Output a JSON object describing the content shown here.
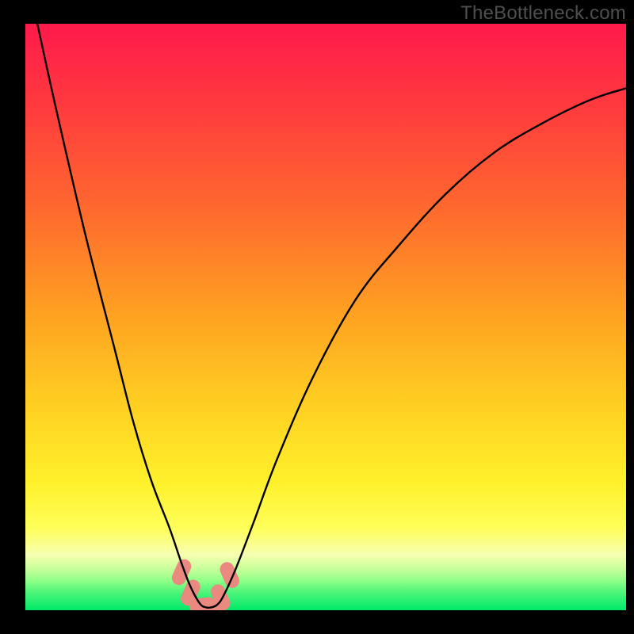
{
  "attribution": "TheBottleneck.com",
  "accent_colors": {
    "curve": "#000000",
    "marker": "#ea8980",
    "top": "#ff1a4c",
    "mid_orange": "#ff7a2b",
    "mid_yellow": "#ffe528",
    "pale_green": "#a3ff78",
    "green": "#00e86a",
    "frame": "#000000"
  },
  "chart_data": {
    "type": "line",
    "title": "",
    "xlabel": "",
    "ylabel": "",
    "xlim": [
      0,
      100
    ],
    "ylim": [
      0,
      100
    ],
    "grid": false,
    "series": [
      {
        "name": "bottleneck-curve",
        "x": [
          2,
          5,
          10,
          15,
          18,
          21,
          24,
          26,
          27.5,
          29,
          30,
          31,
          32,
          33,
          35,
          38,
          42,
          48,
          55,
          62,
          70,
          78,
          86,
          94,
          100
        ],
        "y": [
          100,
          86,
          64,
          44,
          32,
          22,
          14,
          8,
          4,
          1.2,
          0.5,
          0.5,
          1.0,
          2.5,
          7,
          15,
          26,
          40,
          53,
          62,
          71,
          78,
          83,
          87,
          89
        ]
      }
    ],
    "markers": {
      "name": "highlight-markers",
      "x": [
        26.0,
        27.5,
        29.5,
        31.0,
        32.5,
        34.0
      ],
      "y": [
        6.5,
        3.0,
        0.9,
        0.7,
        2.2,
        6.0
      ]
    }
  }
}
